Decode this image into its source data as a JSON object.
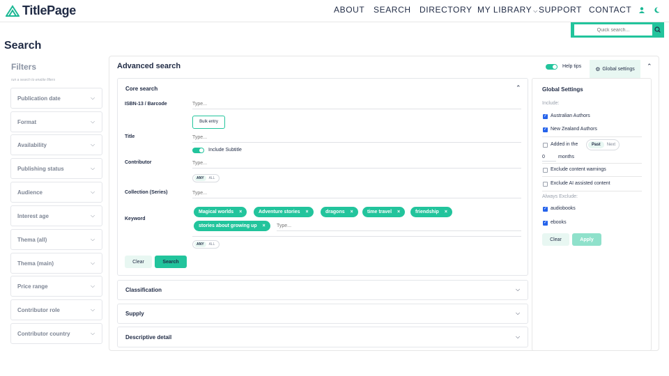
{
  "brand": {
    "name": "TitlePage",
    "accent": "#22c49c"
  },
  "nav": {
    "items": [
      "ABOUT",
      "SEARCH",
      "DIRECTORY",
      "MY LIBRARY",
      "SUPPORT",
      "CONTACT"
    ]
  },
  "quick_search": {
    "placeholder": "Quick search..."
  },
  "page": {
    "title": "Search"
  },
  "filters": {
    "title": "Filters",
    "hint": "run a search to enable filters",
    "items": [
      "Publication date",
      "Format",
      "Availability",
      "Publishing status",
      "Audience",
      "Interest age",
      "Thema (all)",
      "Thema (main)",
      "Price range",
      "Contributor role",
      "Contributor country"
    ]
  },
  "advanced": {
    "title": "Advanced search",
    "help_tips_label": "Help tips",
    "global_settings_label": "Global settings",
    "core": {
      "title": "Core search",
      "isbn_label": "ISBN-13 / Barcode",
      "isbn_placeholder": "Type...",
      "bulk_entry": "Bulk entry",
      "title_label": "Title",
      "title_placeholder": "Type...",
      "include_subtitle": "Include Subtitle",
      "contributor_label": "Contributor",
      "contributor_placeholder": "Type...",
      "any_label": "ANY",
      "all_label": "ALL",
      "collection_label": "Collection (Series)",
      "collection_placeholder": "Type...",
      "keyword_label": "Keyword",
      "keywords": [
        "Magical worlds",
        "Adventure stories",
        "dragons",
        "time travel",
        "friendship",
        "stories about growing up"
      ],
      "keyword_placeholder": "Type...",
      "clear": "Clear",
      "search": "Search"
    },
    "sections": [
      "Classification",
      "Supply",
      "Descriptive detail"
    ]
  },
  "global_settings": {
    "title": "Global Settings",
    "include_label": "Include:",
    "include": [
      {
        "label": "Australian Authors",
        "checked": true
      },
      {
        "label": "New Zealand Authors",
        "checked": true
      }
    ],
    "added_in_label": "Added in the",
    "past": "Past",
    "next": "Next",
    "months_value": "0",
    "months_label": "months",
    "exclude_content_warnings": "Exclude content warnings",
    "exclude_ai": "Exclude AI assisted content",
    "always_exclude_label": "Always Exclude:",
    "always_exclude": [
      {
        "label": "audiobooks",
        "checked": true
      },
      {
        "label": "ebooks",
        "checked": true
      }
    ],
    "clear": "Clear",
    "apply": "Apply"
  }
}
